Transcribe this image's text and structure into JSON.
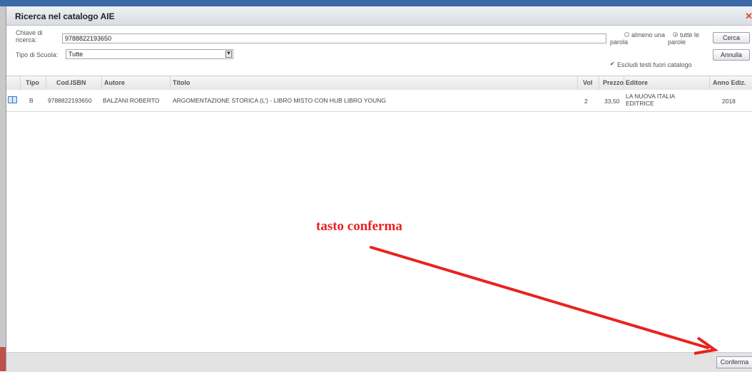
{
  "dialog": {
    "title": "Ricerca nel catalogo AIE",
    "close_icon": "close-icon"
  },
  "search": {
    "key_label_line1": "Chiave di",
    "key_label_line2": "ricerca:",
    "key_value": "9788822193650",
    "school_type_label": "Tipo di Scuola:",
    "school_type_value": "Tutte",
    "match_any_line1": "almeno una",
    "match_any_line2": "parola",
    "match_all_line1": "tutte le",
    "match_all_line2": "parole",
    "match_selected": "all",
    "exclude_label": "Escludi testi fuori catalogo",
    "exclude_checked": true,
    "search_button": "Cerca",
    "cancel_button": "Annulla"
  },
  "table": {
    "headers": {
      "tipo": "Tipo",
      "isbn": "Cod.ISBN",
      "autore": "Autore",
      "titolo": "Titolo",
      "vol": "Vol",
      "prezzo": "Prezzo",
      "editore": "Editore",
      "anno": "Anno Ediz."
    },
    "rows": [
      {
        "icon": "book-icon",
        "tipo": "B",
        "isbn": "9788822193650",
        "autore": "BALZANI ROBERTO",
        "titolo": "ARGOMENTAZIONE STORICA (L') - LIBRO MISTO CON HUB LIBRO YOUNG",
        "vol": "2",
        "prezzo": "33,50",
        "editore_line1": "LA NUOVA ITALIA",
        "editore_line2": "EDITRICE",
        "anno": "2018"
      }
    ]
  },
  "footer": {
    "confirm_button": "Conferma"
  },
  "annotation": {
    "text": "tasto conferma",
    "color": "#e8231f"
  }
}
